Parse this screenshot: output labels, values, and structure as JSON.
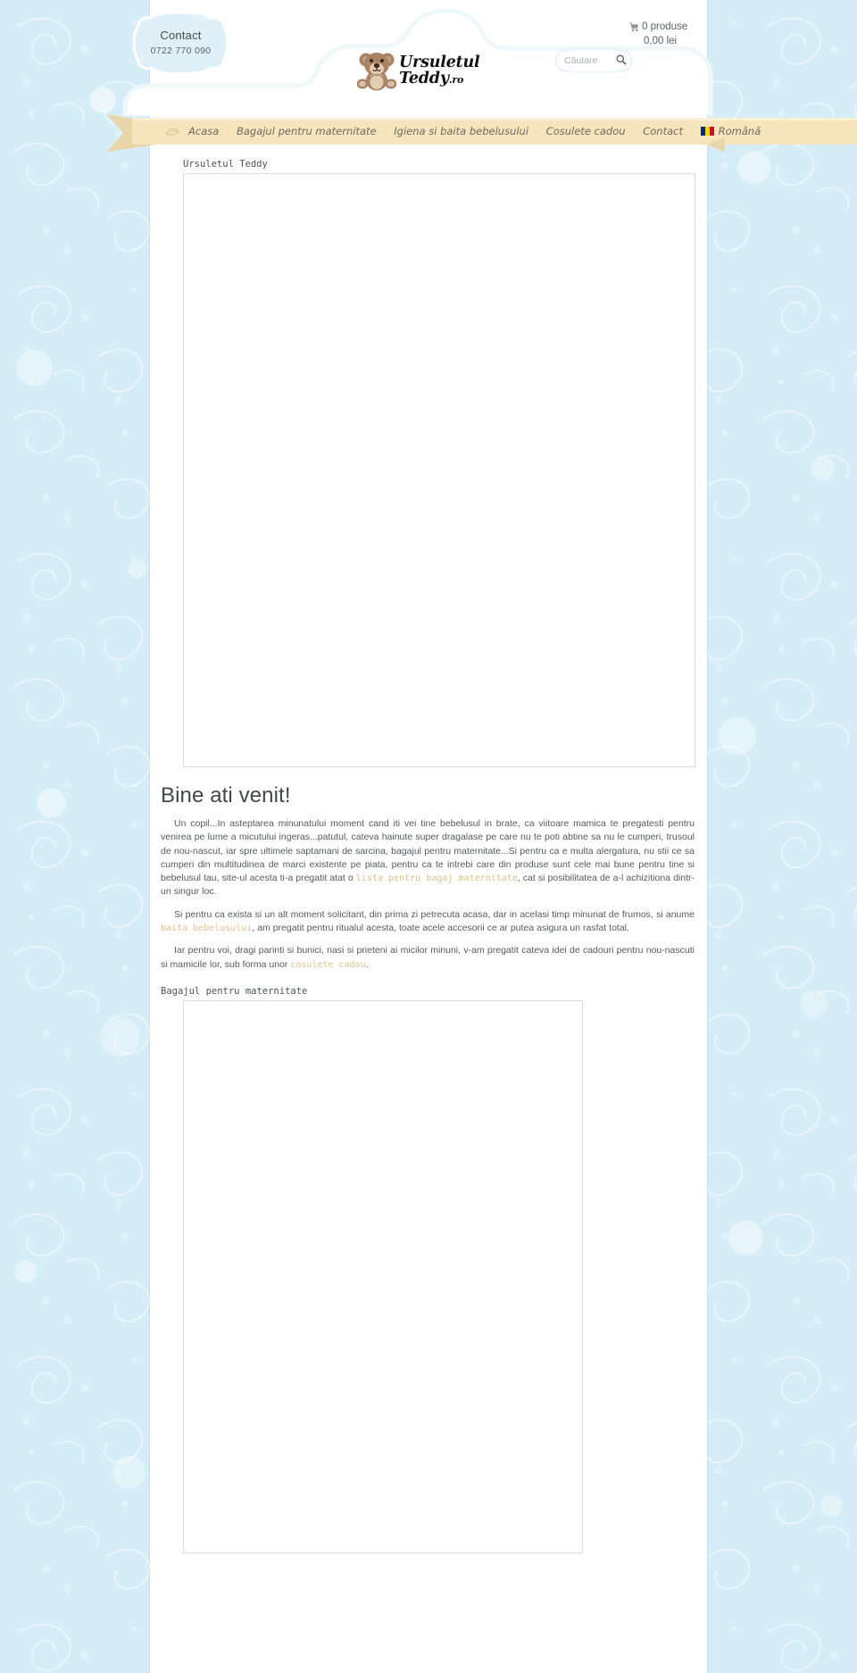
{
  "header": {
    "contact": {
      "title": "Contact",
      "phone": "0722 770 090"
    },
    "logo": {
      "line1": "Ursuletul",
      "line2": "Teddy",
      "suffix": ".ro",
      "bear_icon": "teddy-bear-icon"
    },
    "cart": {
      "icon": "shopping-cart-icon",
      "count_label": "0 produse",
      "total_label": "0,00 lei"
    },
    "search": {
      "placeholder": "Căutare",
      "value": "",
      "icon": "search-icon"
    }
  },
  "nav": {
    "leaf_icon": "leaf-icon",
    "separator": "·",
    "items": [
      {
        "label": "Acasa"
      },
      {
        "label": "Bagajul pentru maternitate"
      },
      {
        "label": "Igiena si baita bebelusului"
      },
      {
        "label": "Cosulete cadou"
      },
      {
        "label": "Contact"
      }
    ],
    "language": {
      "label": "Română",
      "flag_icon": "flag-romania-icon"
    }
  },
  "main": {
    "slider_label": "Ursuletul Teddy",
    "welcome_heading": "Bine ati venit!",
    "paragraph1_a": "Un copil...In asteptarea minunatului moment cand iti vei tine bebelusul in brate, ca viitoare mamica te pregatesti pentru venirea pe lume a micutului ingeras...patutul, cateva hainute super dragalase pe care nu te poti abtine sa nu le cumperi, trusoul de nou-nascut, iar spre ultimele saptamani de sarcina, bagajul pentru maternitate...Si pentru ca e multa alergatura, nu stii ce sa cumperi din multitudinea de marci existente pe piata, pentru ca te intrebi care din produse sunt cele mai bune pentru tine si bebelusul tau, site-ul acesta ti-a pregatit atat o ",
    "paragraph1_link": "lista pentru bagaj maternitate",
    "paragraph1_b": ", cat si posibilitatea de a-l achizitiona dintr-un singur loc.",
    "paragraph2_a": "Si pentru ca exista si un alt moment solicitant, din prima zi petrecuta acasa, dar in acelasi timp minunat de frumos, si anume ",
    "paragraph2_link": "baita bebelusului",
    "paragraph2_b": ", am pregatit pentru ritualul acesta, toate acele accesorii ce ar putea asigura un rasfat total.",
    "paragraph3_a": "Iar pentru voi, dragi parinti si bunici, nasi si prieteni ai micilor minuni, v-am pregatit cateva idei de cadouri pentru nou-nascuti si mamicile lor, sub forma unor ",
    "paragraph3_link": "cosulete cadou",
    "paragraph3_b": ".",
    "bagaj_label": "Bagajul pentru maternitate"
  },
  "colors": {
    "page_background": "#d4edf6",
    "nav_ribbon": "#f6e4bd",
    "nav_text": "#6f6a5f",
    "link_accent": "#dcc08d",
    "body_text": "#55595c",
    "heading": "#44474a"
  }
}
